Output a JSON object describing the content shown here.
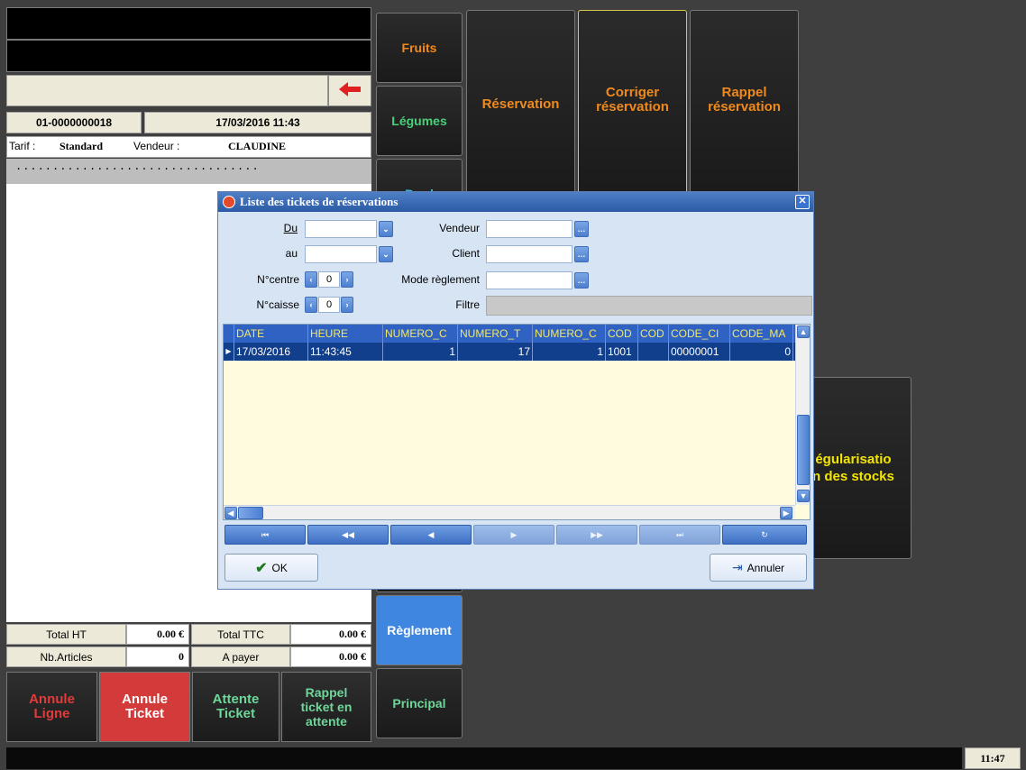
{
  "ticket": {
    "number": "01-0000000018",
    "datetime": "17/03/2016 11:43",
    "tarif_label": "Tarif :",
    "tarif_value": "Standard",
    "vendeur_label": "Vendeur :",
    "vendeur_value": "CLAUDINE",
    "dots": "................................."
  },
  "totals": {
    "total_ht_label": "Total HT",
    "total_ht_value": "0.00 €",
    "total_ttc_label": "Total TTC",
    "total_ttc_value": "0.00 €",
    "nb_articles_label": "Nb.Articles",
    "nb_articles_value": "0",
    "a_payer_label": "A payer",
    "a_payer_value": "0.00 €"
  },
  "bottom_buttons": {
    "annule_ligne": "Annule\nLigne",
    "annule_ticket": "Annule\nTicket",
    "attente_ticket": "Attente\nTicket",
    "rappel_ticket": "Rappel\nticket en\nattente"
  },
  "categories": {
    "fruits": "Fruits",
    "legumes": "Légumes",
    "hidden": "Prod",
    "reglement": "Règlement",
    "principal": "Principal"
  },
  "functions": {
    "reservation": "Réservation",
    "corriger": "Corriger\nréservation",
    "rappel": "Rappel\nréservation",
    "regularisation": "égularisatio\nn des stocks"
  },
  "clock": "11:47",
  "dialog": {
    "title": "Liste des tickets de réservations",
    "du_label": "Du",
    "au_label": "au",
    "ncentre_label": "N°centre",
    "ncentre_value": "0",
    "ncaisse_label": "N°caisse",
    "ncaisse_value": "0",
    "vendeur_label": "Vendeur",
    "client_label": "Client",
    "mode_label": "Mode règlement",
    "filtre_label": "Filtre",
    "columns": [
      "DATE",
      "HEURE",
      "NUMERO_C",
      "NUMERO_T",
      "NUMERO_C",
      "COD",
      "COD",
      "CODE_CI",
      "CODE_MA"
    ],
    "rows": [
      [
        "17/03/2016",
        "11:43:45",
        "1",
        "17",
        "1",
        "1001",
        "",
        "00000001",
        "0"
      ]
    ],
    "ok_label": "OK",
    "cancel_label": "Annuler"
  },
  "colors": {
    "orange": "#f08a1c",
    "green": "#49d17a",
    "yellow": "#f4e600",
    "red_text": "#e23b3b",
    "red_button": "#d33b3b",
    "blue_button": "#3f86e0"
  }
}
